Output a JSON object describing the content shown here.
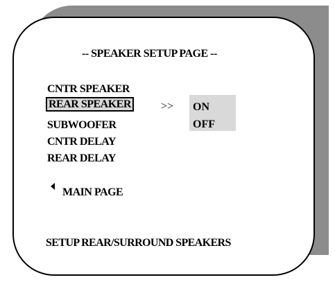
{
  "page_title": "-- SPEAKER SETUP PAGE --",
  "menu": {
    "items": [
      {
        "label": "CNTR SPEAKER"
      },
      {
        "label": "REAR SPEAKER"
      },
      {
        "label": "SUBWOOFER"
      },
      {
        "label": "CNTR DELAY"
      },
      {
        "label": "REAR DELAY"
      }
    ],
    "selected_index": 1,
    "selection_arrow": ">>"
  },
  "options": [
    {
      "label": "ON"
    },
    {
      "label": "OFF"
    }
  ],
  "back": {
    "icon": "triangle-left-icon",
    "label": "MAIN PAGE"
  },
  "footer": "SETUP REAR/SURROUND SPEAKERS",
  "colors": {
    "shadow": "#8c8c8c",
    "highlight": "#d9d9d9",
    "text": "#000000",
    "background": "#ffffff"
  }
}
